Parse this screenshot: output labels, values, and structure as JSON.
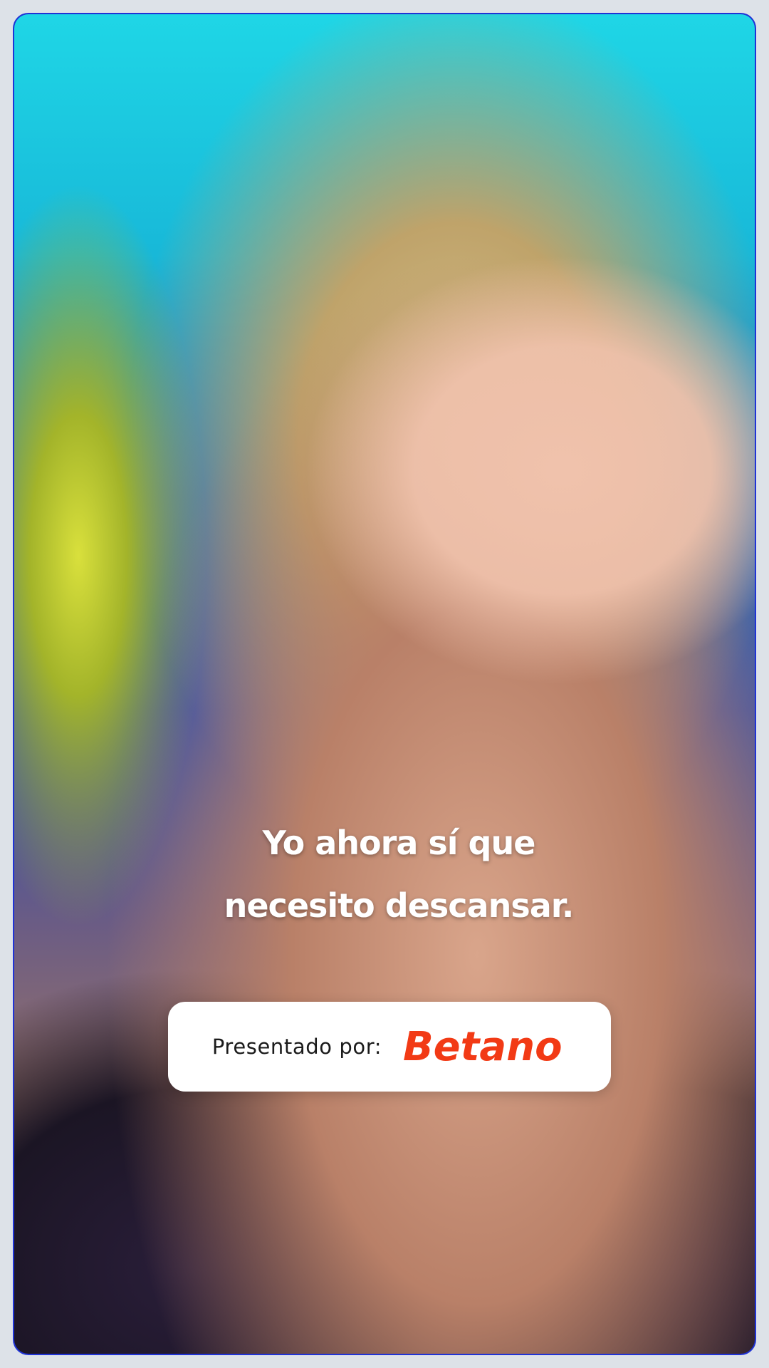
{
  "subtitle": {
    "line1": "Yo ahora sí que",
    "line2": "necesito descansar."
  },
  "sponsor": {
    "label": "Presentado por:",
    "brand_logo_text": "Betano",
    "brand_color": "#f23a15"
  },
  "colors": {
    "frame_border": "#1f33d6",
    "page_background": "#dde2e8"
  }
}
